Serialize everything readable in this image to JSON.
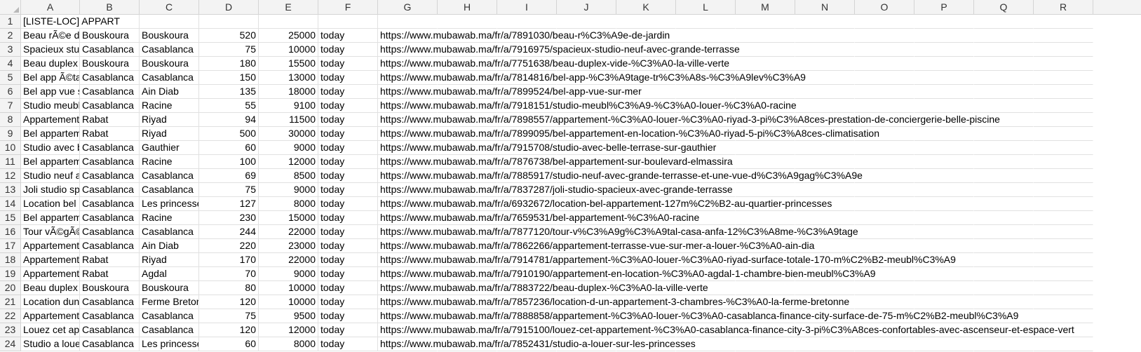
{
  "columns": [
    "A",
    "B",
    "C",
    "D",
    "E",
    "F",
    "G",
    "H",
    "I",
    "J",
    "K",
    "L",
    "M",
    "N",
    "O",
    "P",
    "Q",
    "R"
  ],
  "rows": [
    {
      "n": "1",
      "a": "[LISTE-LOC] APPART",
      "b": "",
      "c": "",
      "d": "",
      "e": "",
      "f": "",
      "g": ""
    },
    {
      "n": "2",
      "a": "Beau rÃ©e de",
      "b": "Bouskoura",
      "c": "Bouskoura",
      "d": "520",
      "e": "25000",
      "f": "today",
      "g": "https://www.mubawab.ma/fr/a/7891030/beau-r%C3%A9e-de-jardin"
    },
    {
      "n": "3",
      "a": "Spacieux stu",
      "b": "Casablanca",
      "c": "Casablanca",
      "d": "75",
      "e": "10000",
      "f": "today",
      "g": "https://www.mubawab.ma/fr/a/7916975/spacieux-studio-neuf-avec-grande-terrasse"
    },
    {
      "n": "4",
      "a": "Beau duplex",
      "b": "Bouskoura",
      "c": "Bouskoura",
      "d": "180",
      "e": "15500",
      "f": "today",
      "g": "https://www.mubawab.ma/fr/a/7751638/beau-duplex-vide-%C3%A0-la-ville-verte"
    },
    {
      "n": "5",
      "a": "Bel app Ã©ta",
      "b": "Casablanca",
      "c": "Casablanca",
      "d": "150",
      "e": "13000",
      "f": "today",
      "g": "https://www.mubawab.ma/fr/a/7814816/bel-app-%C3%A9tage-tr%C3%A8s-%C3%A9lev%C3%A9"
    },
    {
      "n": "6",
      "a": "Bel app vue s",
      "b": "Casablanca",
      "c": "Ain Diab",
      "d": "135",
      "e": "18000",
      "f": "today",
      "g": "https://www.mubawab.ma/fr/a/7899524/bel-app-vue-sur-mer"
    },
    {
      "n": "7",
      "a": "Studio meubl",
      "b": "Casablanca",
      "c": "Racine",
      "d": "55",
      "e": "9100",
      "f": "today",
      "g": "https://www.mubawab.ma/fr/a/7918151/studio-meubl%C3%A9-%C3%A0-louer-%C3%A0-racine"
    },
    {
      "n": "8",
      "a": "Appartement",
      "b": "Rabat",
      "c": "Riyad",
      "d": "94",
      "e": "11500",
      "f": "today",
      "g": "https://www.mubawab.ma/fr/a/7898557/appartement-%C3%A0-louer-%C3%A0-riyad-3-pi%C3%A8ces-prestation-de-conciergerie-belle-piscine"
    },
    {
      "n": "9",
      "a": "Bel appartem",
      "b": "Rabat",
      "c": "Riyad",
      "d": "500",
      "e": "30000",
      "f": "today",
      "g": "https://www.mubawab.ma/fr/a/7899095/bel-appartement-en-location-%C3%A0-riyad-5-pi%C3%A8ces-climatisation"
    },
    {
      "n": "10",
      "a": "Studio avec b",
      "b": "Casablanca",
      "c": "Gauthier",
      "d": "60",
      "e": "9000",
      "f": "today",
      "g": "https://www.mubawab.ma/fr/a/7915708/studio-avec-belle-terrase-sur-gauthier"
    },
    {
      "n": "11",
      "a": "Bel appartem",
      "b": "Casablanca",
      "c": "Racine",
      "d": "100",
      "e": "12000",
      "f": "today",
      "g": "https://www.mubawab.ma/fr/a/7876738/bel-appartement-sur-boulevard-elmassira"
    },
    {
      "n": "12",
      "a": "Studio neuf a",
      "b": "Casablanca",
      "c": "Casablanca",
      "d": "69",
      "e": "8500",
      "f": "today",
      "g": "https://www.mubawab.ma/fr/a/7885917/studio-neuf-avec-grande-terrasse-et-une-vue-d%C3%A9gag%C3%A9e"
    },
    {
      "n": "13",
      "a": "Joli studio sp",
      "b": "Casablanca",
      "c": "Casablanca",
      "d": "75",
      "e": "9000",
      "f": "today",
      "g": "https://www.mubawab.ma/fr/a/7837287/joli-studio-spacieux-avec-grande-terrasse"
    },
    {
      "n": "14",
      "a": "Location bel a",
      "b": "Casablanca",
      "c": "Les princesse",
      "d": "127",
      "e": "8000",
      "f": "today",
      "g": "https://www.mubawab.ma/fr/a/6932672/location-bel-appartement-127m%C2%B2-au-quartier-princesses"
    },
    {
      "n": "15",
      "a": "Bel appartem",
      "b": "Casablanca",
      "c": "Racine",
      "d": "230",
      "e": "15000",
      "f": "today",
      "g": "https://www.mubawab.ma/fr/a/7659531/bel-appartement-%C3%A0-racine"
    },
    {
      "n": "16",
      "a": "Tour vÃ©gÃ©",
      "b": "Casablanca",
      "c": "Casablanca",
      "d": "244",
      "e": "22000",
      "f": "today",
      "g": "https://www.mubawab.ma/fr/a/7877120/tour-v%C3%A9g%C3%A9tal-casa-anfa-12%C3%A8me-%C3%A9tage"
    },
    {
      "n": "17",
      "a": "Appartement",
      "b": "Casablanca",
      "c": "Ain Diab",
      "d": "220",
      "e": "23000",
      "f": "today",
      "g": "https://www.mubawab.ma/fr/a/7862266/appartement-terrasse-vue-sur-mer-a-louer-%C3%A0-ain-dia"
    },
    {
      "n": "18",
      "a": "Appartement",
      "b": "Rabat",
      "c": "Riyad",
      "d": "170",
      "e": "22000",
      "f": "today",
      "g": "https://www.mubawab.ma/fr/a/7914781/appartement-%C3%A0-louer-%C3%A0-riyad-surface-totale-170-m%C2%B2-meubl%C3%A9"
    },
    {
      "n": "19",
      "a": "Appartement",
      "b": "Rabat",
      "c": "Agdal",
      "d": "70",
      "e": "9000",
      "f": "today",
      "g": "https://www.mubawab.ma/fr/a/7910190/appartement-en-location-%C3%A0-agdal-1-chambre-bien-meubl%C3%A9"
    },
    {
      "n": "20",
      "a": "Beau duplex",
      "b": "Bouskoura",
      "c": "Bouskoura",
      "d": "80",
      "e": "10000",
      "f": "today",
      "g": "https://www.mubawab.ma/fr/a/7883722/beau-duplex-%C3%A0-la-ville-verte"
    },
    {
      "n": "21",
      "a": "Location dun",
      "b": "Casablanca",
      "c": "Ferme Bretor",
      "d": "120",
      "e": "10000",
      "f": "today",
      "g": "https://www.mubawab.ma/fr/a/7857236/location-d-un-appartement-3-chambres-%C3%A0-la-ferme-bretonne"
    },
    {
      "n": "22",
      "a": "Appartement",
      "b": "Casablanca",
      "c": "Casablanca",
      "d": "75",
      "e": "9500",
      "f": "today",
      "g": "https://www.mubawab.ma/fr/a/7888858/appartement-%C3%A0-louer-%C3%A0-casablanca-finance-city-surface-de-75-m%C2%B2-meubl%C3%A9"
    },
    {
      "n": "23",
      "a": "Louez cet app",
      "b": "Casablanca",
      "c": "Casablanca",
      "d": "120",
      "e": "12000",
      "f": "today",
      "g": "https://www.mubawab.ma/fr/a/7915100/louez-cet-appartement-%C3%A0-casablanca-finance-city-3-pi%C3%A8ces-confortables-avec-ascenseur-et-espace-vert"
    },
    {
      "n": "24",
      "a": "Studio a louer",
      "b": "Casablanca",
      "c": "Les princesse",
      "d": "60",
      "e": "8000",
      "f": "today",
      "g": "https://www.mubawab.ma/fr/a/7852431/studio-a-louer-sur-les-princesses"
    }
  ]
}
